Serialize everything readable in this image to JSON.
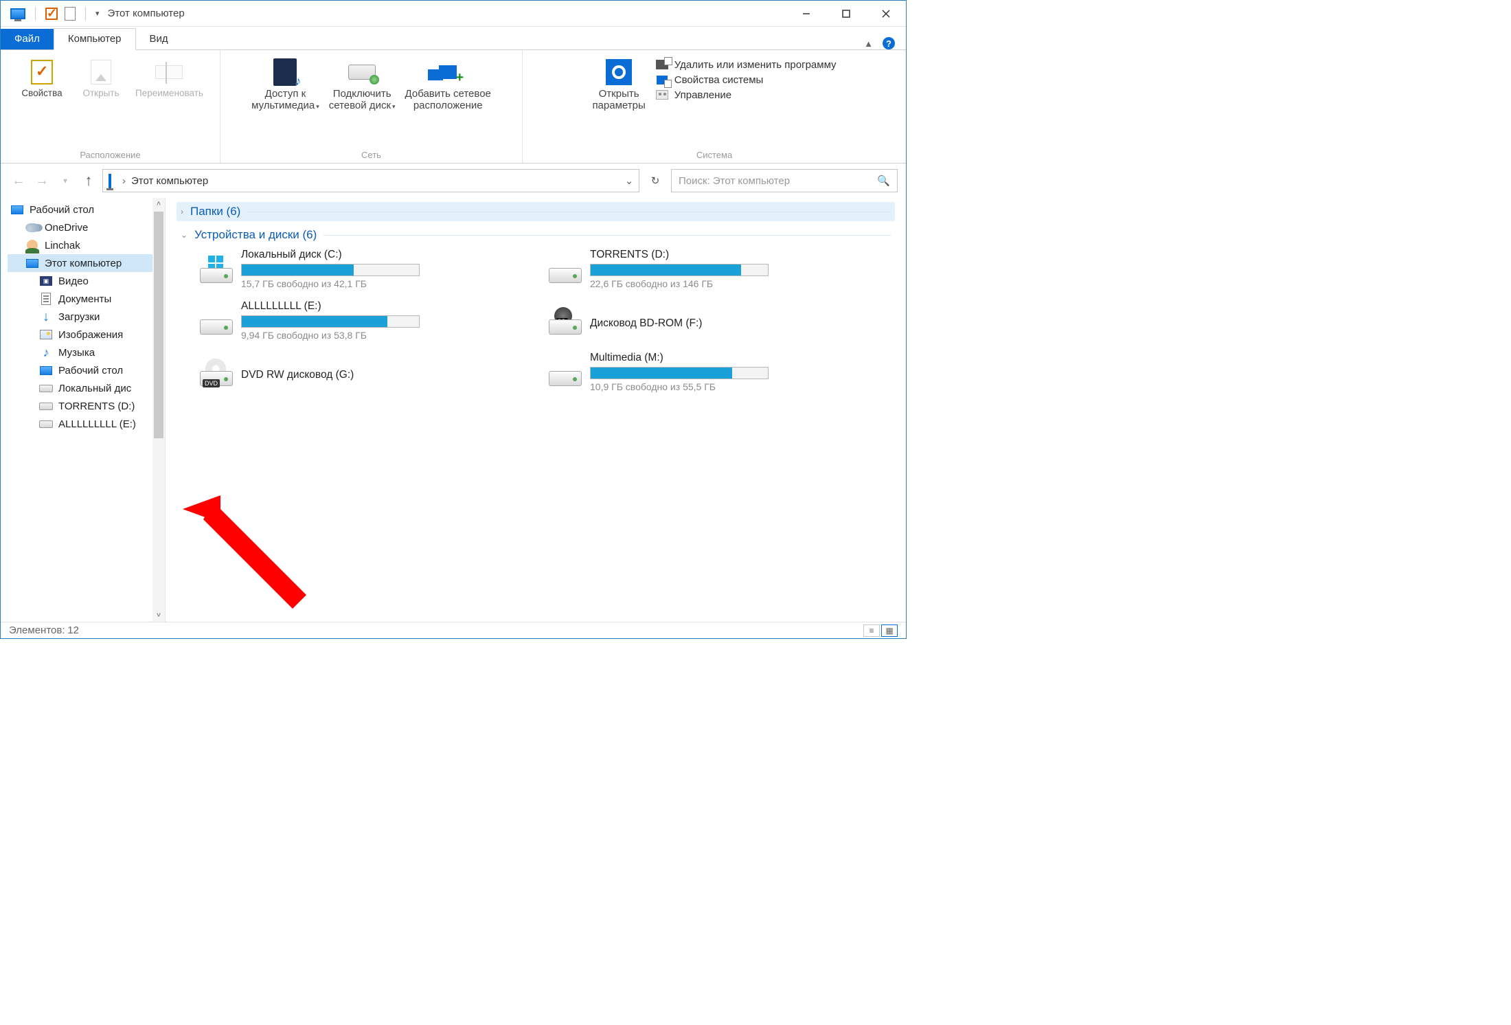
{
  "window": {
    "title": "Этот компьютер"
  },
  "tabs": {
    "file": "Файл",
    "computer": "Компьютер",
    "view": "Вид"
  },
  "ribbon": {
    "location": {
      "label": "Расположение",
      "properties": "Свойства",
      "open": "Открыть",
      "rename": "Переименовать"
    },
    "network": {
      "label": "Сеть",
      "media_l1": "Доступ к",
      "media_l2": "мультимедиа",
      "map_l1": "Подключить",
      "map_l2": "сетевой диск",
      "addloc_l1": "Добавить сетевое",
      "addloc_l2": "расположение"
    },
    "system": {
      "label": "Система",
      "settings_l1": "Открыть",
      "settings_l2": "параметры",
      "uninstall": "Удалить или изменить программу",
      "sysprops": "Свойства системы",
      "manage": "Управление"
    }
  },
  "address": {
    "text": "Этот компьютер"
  },
  "search": {
    "placeholder": "Поиск: Этот компьютер"
  },
  "nav": {
    "desktop": "Рабочий стол",
    "onedrive": "OneDrive",
    "user": "Linchak",
    "thispc": "Этот компьютер",
    "videos": "Видео",
    "documents": "Документы",
    "downloads": "Загрузки",
    "pictures": "Изображения",
    "music": "Музыка",
    "desktop2": "Рабочий стол",
    "localc": "Локальный дис",
    "torrents": "TORRENTS (D:)",
    "all_e": "ALLLLLLLLL (E:)"
  },
  "groups": {
    "folders": "Папки (6)",
    "devices": "Устройства и диски (6)"
  },
  "drives": {
    "c": {
      "title": "Локальный диск (C:)",
      "stat": "15,7 ГБ свободно из 42,1 ГБ",
      "fill": 63
    },
    "d": {
      "title": "TORRENTS (D:)",
      "stat": "22,6 ГБ свободно из 146 ГБ",
      "fill": 85
    },
    "e": {
      "title": "ALLLLLLLLL (E:)",
      "stat": "9,94 ГБ свободно из 53,8 ГБ",
      "fill": 82
    },
    "f": {
      "title": "Дисковод BD-ROM (F:)"
    },
    "g": {
      "title": "DVD RW дисковод (G:)"
    },
    "m": {
      "title": "Multimedia (M:)",
      "stat": "10,9 ГБ свободно из 55,5 ГБ",
      "fill": 80
    }
  },
  "status": {
    "items_label": "Элементов:",
    "items_count": "12"
  }
}
